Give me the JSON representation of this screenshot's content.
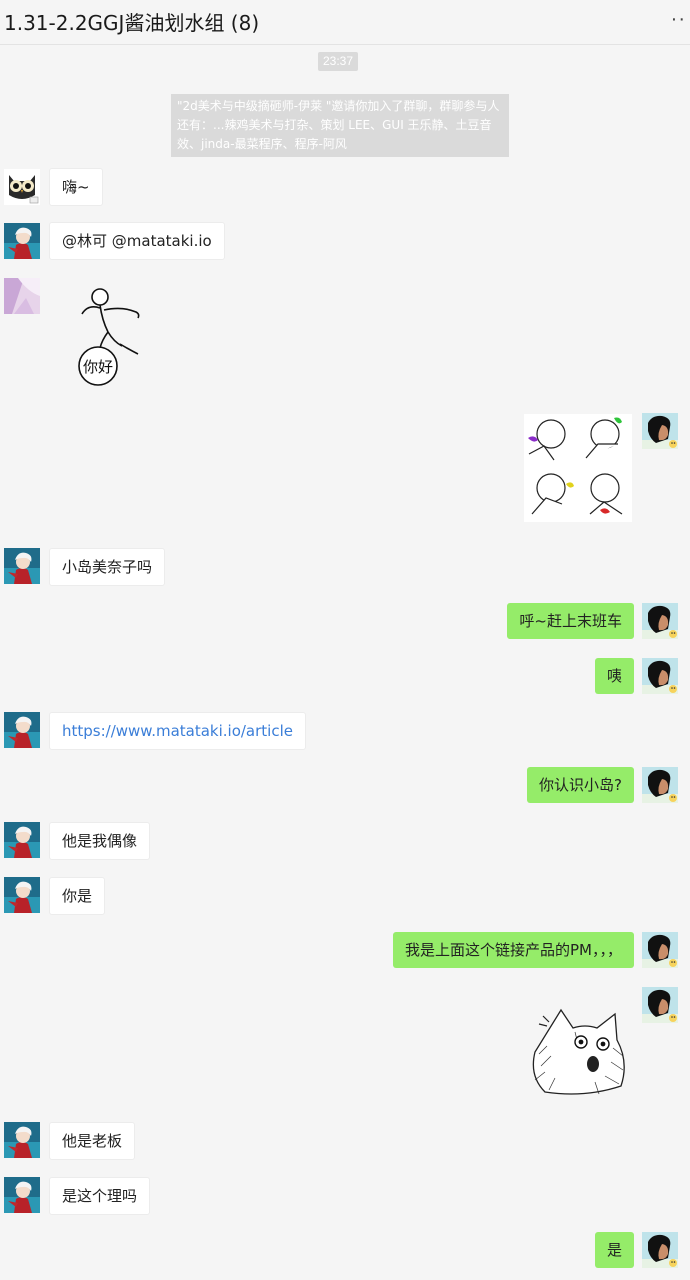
{
  "header": {
    "title": "1.31-2.2GGJ酱油划水组 (8)",
    "more_icon": "··"
  },
  "timestamp": "23:37",
  "system_notice": "\"2d美术与中级摘砸师-伊莱 \"邀请你加入了群聊，群聊参与人还有：...辣鸡美术与打杂、策划 LEE、GUI 王乐静、土豆音效、jinda-最菜程序、程序-阿风",
  "sticker_text": {
    "nihao": "你好"
  },
  "messages": [
    {
      "text": "嗨~"
    },
    {
      "text": "@林可 @matataki.io"
    },
    {
      "text": "小岛美奈子吗"
    },
    {
      "text": "呼~赶上末班车"
    },
    {
      "text": "咦"
    },
    {
      "text": "https://www.matataki.io/article"
    },
    {
      "text": "你认识小岛?"
    },
    {
      "text": "他是我偶像"
    },
    {
      "text": "你是"
    },
    {
      "text": "我是上面这个链接产品的PM，，，"
    },
    {
      "text": "他是老板"
    },
    {
      "text": "是这个理吗"
    },
    {
      "text": "是"
    }
  ],
  "colors": {
    "incoming_bubble": "#ffffff",
    "outgoing_bubble": "#95ec69",
    "link": "#3b7ed8",
    "background": "#f5f5f5"
  }
}
